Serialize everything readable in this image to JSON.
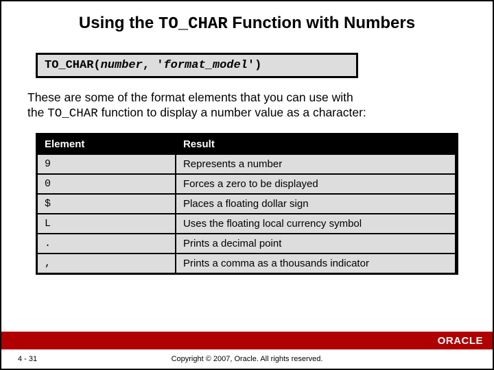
{
  "title": {
    "pre": "Using the ",
    "code": "TO_CHAR",
    "post": " Function with Numbers"
  },
  "syntax": {
    "fn": "TO_CHAR(",
    "arg1": "number",
    "sep": ", '",
    "arg2": "format_model",
    "close": "')"
  },
  "intro": {
    "line1a": "These are some of the format elements that you can use with",
    "line2a": "the ",
    "code": "TO_CHAR",
    "line2b": " function to display a number value as a character:"
  },
  "table": {
    "headers": {
      "h1": "Element",
      "h2": "Result"
    },
    "rows": [
      {
        "elem": "9",
        "result": "Represents a number"
      },
      {
        "elem": "0",
        "result": "Forces a zero to be displayed"
      },
      {
        "elem": "$",
        "result": "Places a floating dollar sign"
      },
      {
        "elem": "L",
        "result": "Uses the floating local currency symbol"
      },
      {
        "elem": ".",
        "result": "Prints a decimal point"
      },
      {
        "elem": ",",
        "result": "Prints a comma as a thousands indicator"
      }
    ]
  },
  "footer": {
    "brand": "ORACLE",
    "page": "4 - 31",
    "copyright": "Copyright © 2007, Oracle. All rights reserved."
  }
}
